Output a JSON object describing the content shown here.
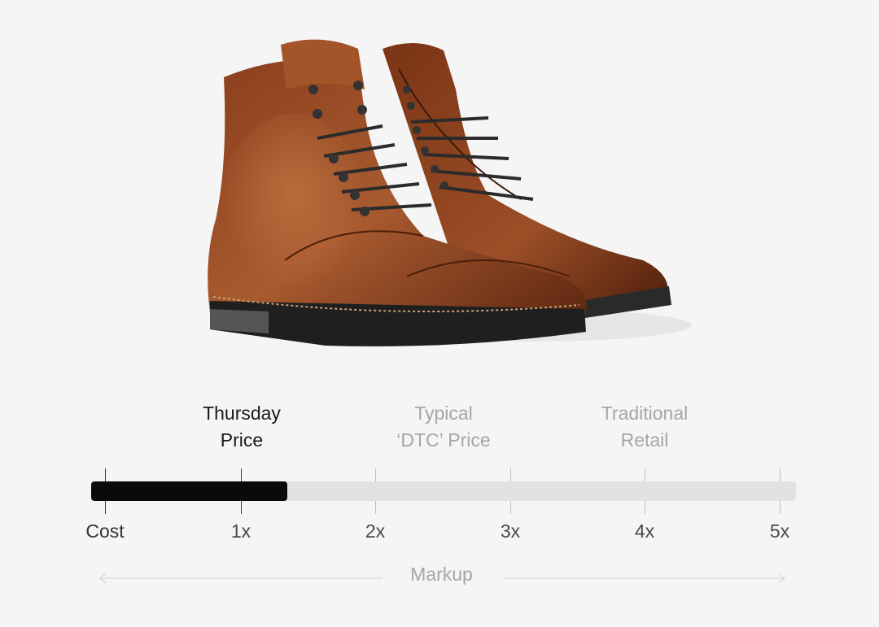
{
  "product": {
    "image_desc": "brown-leather-cap-toe-boots"
  },
  "comparison": {
    "labels": [
      {
        "line1": "Thursday",
        "line2": "Price",
        "emphasis": true
      },
      {
        "line1": "Typical",
        "line2": "‘DTC’ Price",
        "emphasis": false
      },
      {
        "line1": "Traditional",
        "line2": "Retail",
        "emphasis": false
      }
    ],
    "axis": [
      "Cost",
      "1x",
      "2x",
      "3x",
      "4x",
      "5x"
    ],
    "axis_title": "Markup",
    "thursday_markup": 1.35,
    "max_markup": 5
  },
  "colors": {
    "fill": "#0a0a0a",
    "track": "#e2e2e2",
    "muted_text": "#a6a6a6"
  }
}
